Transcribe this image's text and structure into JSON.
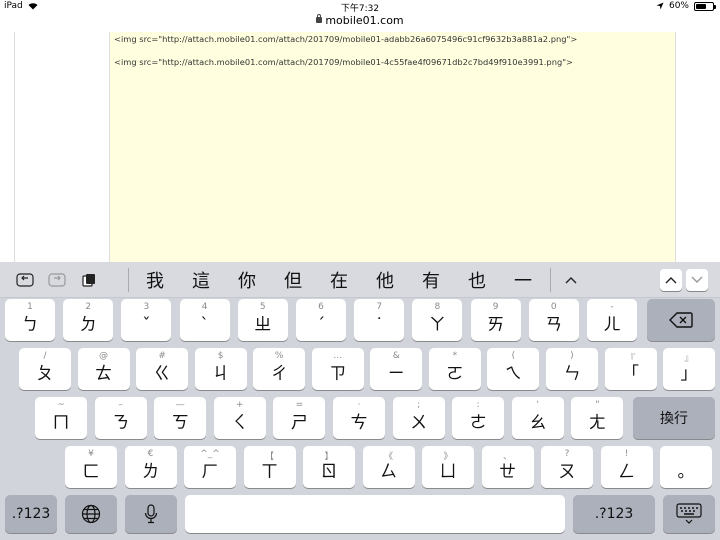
{
  "status": {
    "device": "iPad",
    "time": "下午7:32",
    "battery": "60%",
    "battery_level": 0.6
  },
  "url": {
    "host": "mobile01.com"
  },
  "editor": {
    "lines": [
      "<img src=\"http://attach.mobile01.com/attach/201709/mobile01-adabb26a6075496c91cf9632b3a881a2.png\">",
      "<img src=\"http://attach.mobile01.com/attach/201709/mobile01-4c55fae4f09671db2c7bd49f910e3991.png\">"
    ]
  },
  "candidates": [
    "我",
    "這",
    "你",
    "但",
    "在",
    "他",
    "有",
    "也",
    "一"
  ],
  "keys": {
    "row1": [
      [
        "1",
        "ㄅ"
      ],
      [
        "2",
        "ㄉ"
      ],
      [
        "3",
        "ˇ"
      ],
      [
        "4",
        "ˋ"
      ],
      [
        "5",
        "ㄓ"
      ],
      [
        "6",
        "ˊ"
      ],
      [
        "7",
        "˙"
      ],
      [
        "8",
        "ㄚ"
      ],
      [
        "9",
        "ㄞ"
      ],
      [
        "0",
        "ㄢ"
      ],
      [
        "-",
        "ㄦ"
      ]
    ],
    "row2": [
      [
        "/",
        "ㄆ"
      ],
      [
        "@",
        "ㄊ"
      ],
      [
        "#",
        "ㄍ"
      ],
      [
        "$",
        "ㄐ"
      ],
      [
        "%",
        "ㄔ"
      ],
      [
        "…",
        "ㄗ"
      ],
      [
        "&",
        "ㄧ"
      ],
      [
        "*",
        "ㄛ"
      ],
      [
        "(",
        "ㄟ"
      ],
      [
        ")",
        "ㄣ"
      ],
      [
        "『",
        "「"
      ],
      [
        "』",
        "」"
      ]
    ],
    "row3": [
      [
        "~",
        "ㄇ"
      ],
      [
        "–",
        "ㄋ"
      ],
      [
        "—",
        "ㄎ"
      ],
      [
        "+",
        "ㄑ"
      ],
      [
        "=",
        "ㄕ"
      ],
      [
        "·",
        "ㄘ"
      ],
      [
        ";",
        "ㄨ"
      ],
      [
        ":",
        "ㄜ"
      ],
      [
        "'",
        "ㄠ"
      ],
      [
        "\"",
        "ㄤ"
      ]
    ],
    "row4": [
      [
        "¥",
        "ㄈ"
      ],
      [
        "€",
        "ㄌ"
      ],
      [
        "^_^",
        "ㄏ"
      ],
      [
        "【",
        "ㄒ"
      ],
      [
        "】",
        "ㄖ"
      ],
      [
        "《",
        "ㄙ"
      ],
      [
        "》",
        "ㄩ"
      ],
      [
        "、",
        "ㄝ"
      ],
      [
        "?",
        "ㄡ"
      ],
      [
        "!",
        "ㄥ"
      ],
      [
        "",
        "。"
      ]
    ]
  },
  "labels": {
    "return": "換行",
    "numbers": ".?123"
  },
  "icons": {
    "undo": "undo-icon",
    "redo": "redo-icon",
    "paste": "paste-icon",
    "delete": "backspace-icon",
    "globe": "globe-icon",
    "mic": "mic-icon",
    "hide": "keyboard-hide-icon",
    "up": "chevron-up-icon",
    "down": "chevron-down-icon"
  }
}
